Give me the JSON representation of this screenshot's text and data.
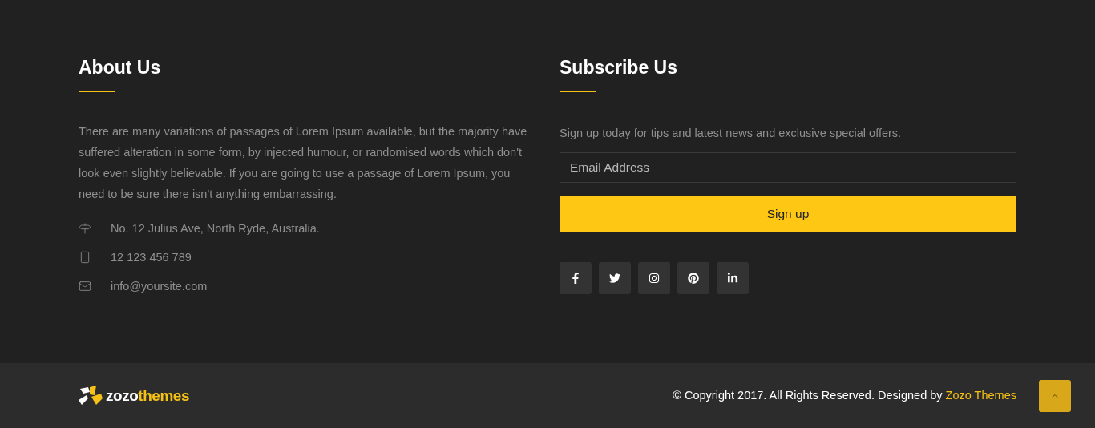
{
  "about": {
    "title": "About Us",
    "text": "There are many variations of passages of Lorem Ipsum available, but the majority have suffered alteration in some form, by injected humour, or randomised words which don't look even slightly believable. If you are going to use a passage of Lorem Ipsum, you need to be sure there isn't anything embarrassing.",
    "contacts": [
      {
        "kind": "address",
        "text": "No. 12 Julius Ave, North Ryde, Australia."
      },
      {
        "kind": "phone",
        "text": "12 123 456 789"
      },
      {
        "kind": "email",
        "text": "info@yoursite.com"
      }
    ]
  },
  "subscribe": {
    "title": "Subscribe Us",
    "text": "Sign up today for tips and latest news and exclusive special offers.",
    "email": {
      "placeholder": "Email Address"
    },
    "button": "Sign up",
    "social": [
      {
        "kind": "facebook"
      },
      {
        "kind": "twitter"
      },
      {
        "kind": "instagram"
      },
      {
        "kind": "pinterest"
      },
      {
        "kind": "linkedin"
      }
    ]
  },
  "bottom": {
    "logo": {
      "part_1": "zozo",
      "part_2": "themes"
    },
    "copyright": "© Copyright 2017. All Rights Reserved. Designed by",
    "link": "Zozo Themes"
  }
}
